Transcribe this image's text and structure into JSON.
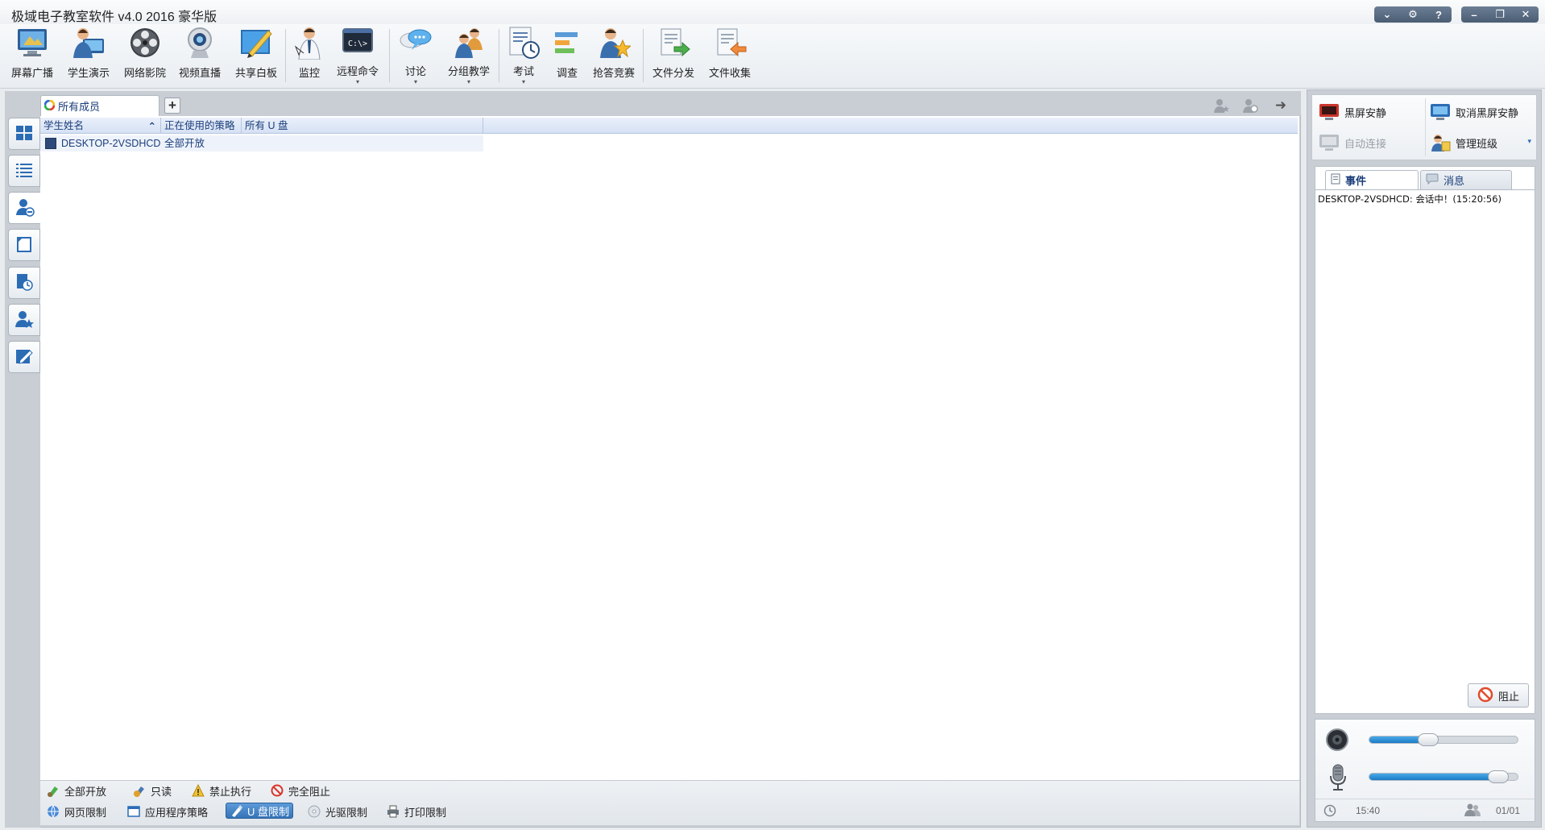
{
  "window": {
    "title": "极域电子教室软件 v4.0 2016 豪华版",
    "controls_left": [
      "collapse-icon",
      "gear-icon",
      "help-icon"
    ],
    "controls_right": [
      "minimize-icon",
      "restore-icon",
      "close-icon"
    ],
    "control_glyphs": {
      "collapse": "⌄",
      "gear": "⚙",
      "help": "?",
      "minimize": "–",
      "restore": "❐",
      "close": "✕"
    }
  },
  "toolbar": {
    "items": [
      {
        "label": "屏幕广播",
        "icon": "screen-broadcast-icon"
      },
      {
        "label": "学生演示",
        "icon": "student-demo-icon"
      },
      {
        "label": "网络影院",
        "icon": "film-reel-icon"
      },
      {
        "label": "视频直播",
        "icon": "webcam-icon"
      },
      {
        "label": "共享白板",
        "icon": "whiteboard-icon"
      },
      {
        "label": "监控",
        "icon": "monitor-person-icon"
      },
      {
        "label": "远程命令",
        "icon": "command-prompt-icon",
        "dropdown": true
      },
      {
        "label": "讨论",
        "icon": "chat-bubbles-icon",
        "dropdown": true
      },
      {
        "label": "分组教学",
        "icon": "group-people-icon",
        "dropdown": true
      },
      {
        "label": "考试",
        "icon": "exam-clock-icon",
        "dropdown": true
      },
      {
        "label": "调查",
        "icon": "survey-bars-icon"
      },
      {
        "label": "抢答竞赛",
        "icon": "quiz-star-icon"
      },
      {
        "label": "文件分发",
        "icon": "file-send-icon"
      },
      {
        "label": "文件收集",
        "icon": "file-collect-icon"
      }
    ],
    "dropdown_glyph": "▾",
    "cmd_text": "C:\\>"
  },
  "sidebar": {
    "buttons": [
      {
        "name": "thumbnail-view",
        "icon": "grid-tiles-icon"
      },
      {
        "name": "list-view",
        "icon": "list-icon"
      },
      {
        "name": "user-policy",
        "icon": "user-minus-icon",
        "active": true
      },
      {
        "name": "document",
        "icon": "document-icon"
      },
      {
        "name": "history",
        "icon": "doc-clock-icon"
      },
      {
        "name": "favorites",
        "icon": "user-star-icon"
      },
      {
        "name": "edit",
        "icon": "pen-edit-icon"
      }
    ]
  },
  "tabs": {
    "active_label": "所有成员",
    "add_glyph": "+",
    "right_icons": [
      "user-star-icon",
      "user-group-icon",
      "arrow-right-icon"
    ],
    "arrow_glyph": "➜"
  },
  "grid": {
    "columns": [
      "学生姓名",
      "正在使用的策略",
      "所有 U 盘"
    ],
    "sort_glyph": "⌃",
    "rows": [
      {
        "name": "DESKTOP-2VSDHCD",
        "policy": "全部开放",
        "usb": ""
      }
    ]
  },
  "policy_bar": {
    "row1": [
      {
        "label": "全部开放",
        "icon": "all-open-icon"
      },
      {
        "label": "只读",
        "icon": "read-only-icon"
      },
      {
        "label": "禁止执行",
        "icon": "no-execute-icon"
      },
      {
        "label": "完全阻止",
        "icon": "block-all-icon"
      }
    ],
    "row2": [
      {
        "label": "网页限制",
        "icon": "globe-icon"
      },
      {
        "label": "应用程序策略",
        "icon": "app-window-icon"
      },
      {
        "label": "U 盘限制",
        "icon": "usb-pen-icon",
        "selected": true
      },
      {
        "label": "光驱限制",
        "icon": "disc-icon"
      },
      {
        "label": "打印限制",
        "icon": "printer-icon"
      }
    ]
  },
  "right_panel": {
    "buttons": [
      {
        "label": "黑屏安静",
        "icon": "black-screen-icon"
      },
      {
        "label": "取消黑屏安静",
        "icon": "cancel-black-screen-icon"
      },
      {
        "label": "自动连接",
        "icon": "auto-connect-icon",
        "disabled": true
      },
      {
        "label": "管理班级",
        "icon": "manage-class-icon",
        "dropdown": true
      }
    ],
    "tabs": [
      {
        "label": "事件",
        "icon": "event-doc-icon",
        "active": true
      },
      {
        "label": "消息",
        "icon": "message-bubble-icon"
      }
    ],
    "event_log": [
      "DESKTOP-2VSDHCD: 会话中！(15:20:56)"
    ],
    "block_button": "阻止"
  },
  "audio": {
    "speaker_level": 0.38,
    "mic_level": 0.93,
    "time": "15:40",
    "count": "01/01"
  },
  "colors": {
    "accent": "#1c7cc6",
    "link_text": "#1a3d7a",
    "selection": "#3574b8"
  }
}
